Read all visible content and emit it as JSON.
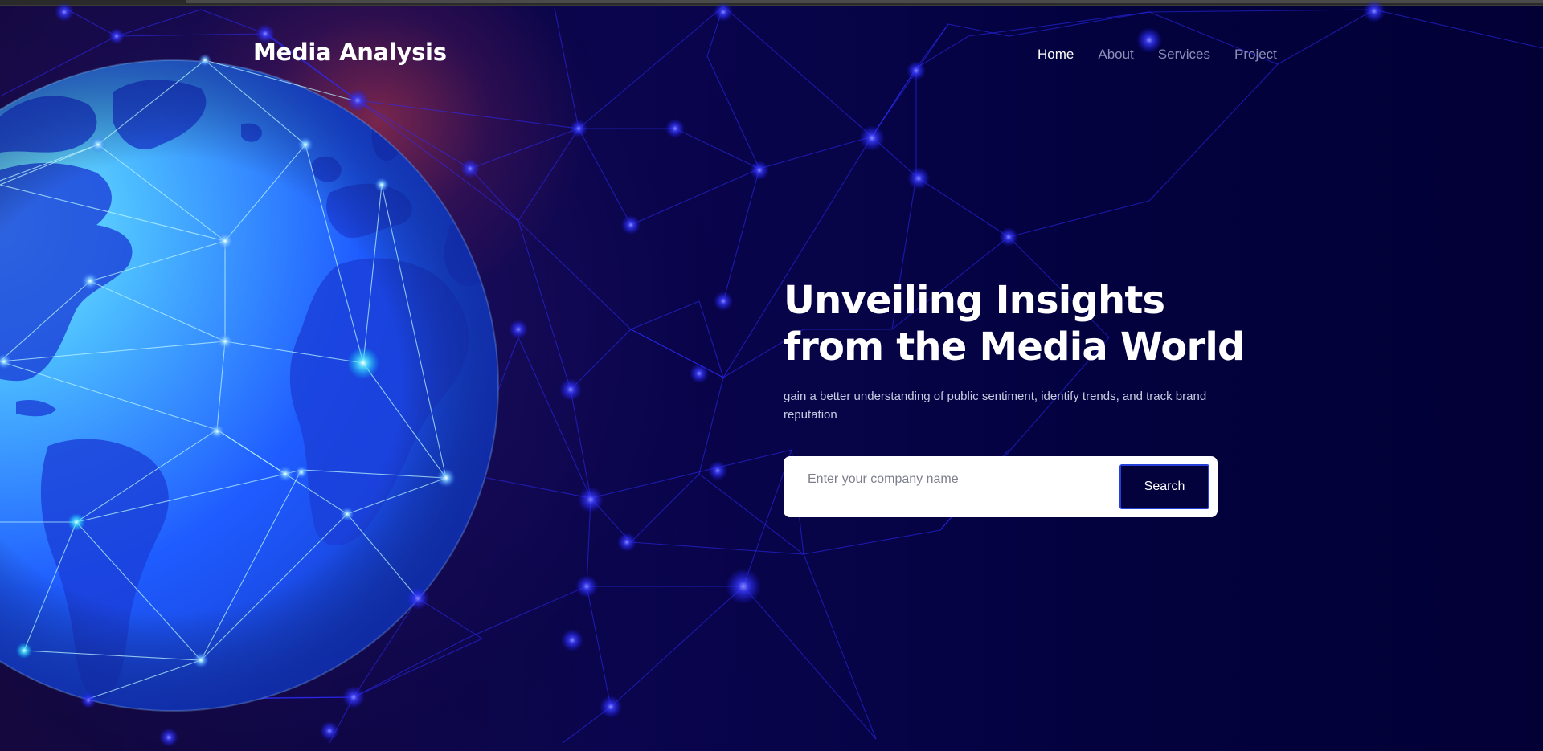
{
  "brand": {
    "name": "Media Analysis"
  },
  "nav": {
    "items": [
      {
        "label": "Home",
        "active": true
      },
      {
        "label": "About",
        "active": false
      },
      {
        "label": "Services",
        "active": false
      },
      {
        "label": "Project",
        "active": false
      }
    ]
  },
  "hero": {
    "title_line1": "Unveiling Insights",
    "title_line2": "from the Media World",
    "subtitle": "gain a better understanding of public sentiment, identify trends, and track brand reputation"
  },
  "search": {
    "placeholder": "Enter your company name",
    "value": "",
    "button_label": "Search"
  },
  "colors": {
    "background": "#020035",
    "accent": "#2440d8",
    "button_bg": "#03023d",
    "globe": "#2a6bff"
  },
  "icons": {
    "globe": "globe-network-illustration"
  }
}
